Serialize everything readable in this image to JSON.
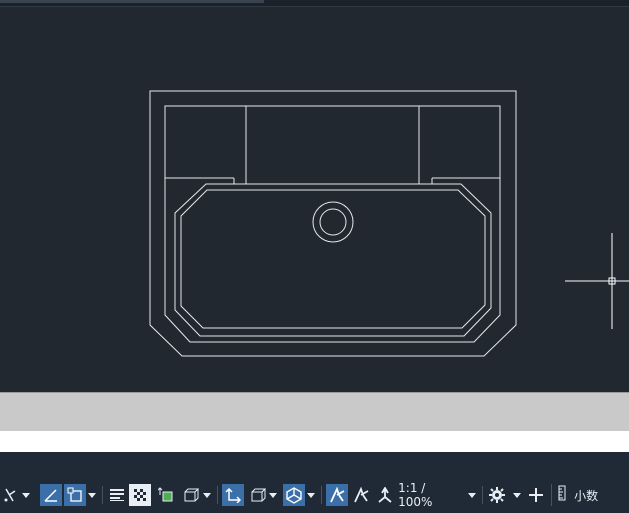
{
  "app": {
    "background_color": "#212830"
  },
  "drawing": {
    "object": "sink-outline",
    "line_color": "#e6e9ec",
    "crosshair_color": "#ffffff"
  },
  "statusbar": {
    "annotation_scale": "1:1 / 100%",
    "units_label": "小数",
    "icons": [
      "polar-tracking-icon",
      "dropdown-arrow",
      "isometric-angle-icon",
      "object-snap-icon",
      "dropdown-arrow",
      "lineweight-icon",
      "transparency-icon",
      "selection-cycling-icon",
      "3d-object-snap-icon",
      "dropdown-arrow",
      "dynamic-ucs-icon",
      "selection-filter-icon",
      "dropdown-arrow",
      "gizmo-icon",
      "dropdown-arrow",
      "annotation-visibility-icon",
      "auto-scale-icon",
      "annotation-scale-icon",
      "dropdown-arrow",
      "workspace-gear-icon",
      "dropdown-arrow",
      "annotation-monitor-icon",
      "units-icon"
    ],
    "accent_color": "#3a6fa8"
  }
}
